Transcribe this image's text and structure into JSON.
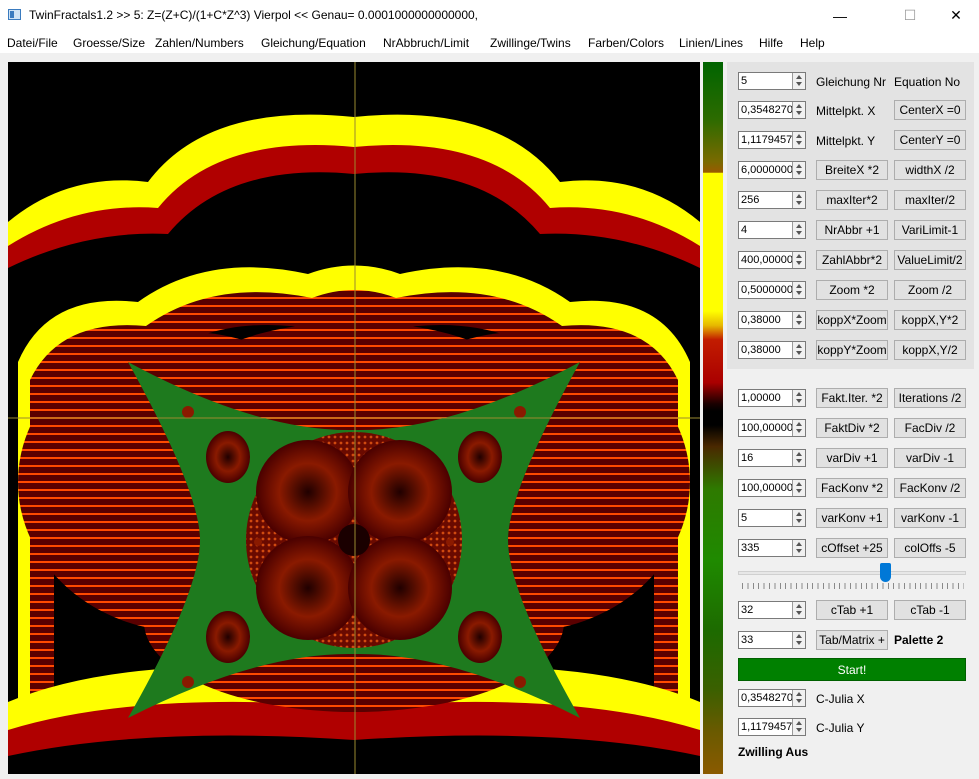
{
  "window": {
    "title": "TwinFractals1.2 >> 5: Z=(Z+C)/(1+C*Z^3) Vierpol << Genau= 0.0001000000000000,",
    "minimize": "—",
    "maximize": "☐",
    "close": "✕"
  },
  "menu": [
    "Datei/File",
    "Groesse/Size",
    "Zahlen/Numbers",
    "Gleichung/Equation",
    "NrAbbruch/Limit",
    "Zwillinge/Twins",
    "Farben/Colors",
    "Linien/Lines",
    "Hilfe",
    "Help"
  ],
  "panel": {
    "equation_no": "5",
    "label_gleichung": "Gleichung Nr",
    "label_equation": "Equation No",
    "mittelpkt_x": "0,3548270",
    "label_mittelpkt_x": "Mittelpkt. X",
    "btn_center_x": "CenterX =0",
    "mittelpkt_y": "1,1179457",
    "label_mittelpkt_y": "Mittelpkt. Y",
    "btn_center_y": "CenterY =0",
    "breite": "6,0000000",
    "btn_breite": "BreiteX *2",
    "btn_width": "widthX /2",
    "maxiter": "256",
    "btn_maxiter_mul": "maxIter*2",
    "btn_maxiter_div": "maxIter/2",
    "nrabbr": "4",
    "btn_nrabbr": "NrAbbr +1",
    "btn_varilimit": "VariLimit-1",
    "zahlabbr": "400,00000",
    "btn_zahlabbr": "ZahlAbbr*2",
    "btn_valuelimit": "ValueLimit/2",
    "zoom": "0,5000000",
    "btn_zoom_mul": "Zoom *2",
    "btn_zoom_div": "Zoom /2",
    "koppx": "0,38000",
    "btn_koppx_zoom": "koppX*Zoom",
    "btn_koppxy_mul": "koppX,Y*2",
    "koppy": "0,38000",
    "btn_koppy_zoom": "koppY*Zoom",
    "btn_koppxy_div": "koppX,Y/2"
  },
  "lower": {
    "fakt_iter": "1,00000",
    "btn_fakt_iter": "Fakt.Iter. *2",
    "btn_iterations": "Iterations /2",
    "fakt_div": "100,00000",
    "btn_fakt_div": "FaktDiv *2",
    "btn_fac_div": "FacDiv /2",
    "var_div": "16",
    "btn_var_div_plus": "varDiv +1",
    "btn_var_div_minus": "varDiv -1",
    "fac_konv": "100,00000",
    "btn_fac_konv_mul": "FacKonv *2",
    "btn_fac_konv_div": "FacKonv /2",
    "var_konv": "5",
    "btn_var_konv_plus": "varKonv +1",
    "btn_var_konv_minus": "varKonv -1",
    "c_offset": "335",
    "btn_c_offset": "cOffset +25",
    "btn_col_offs": "colOffs -5",
    "slider_level": 0.65,
    "c_tab": "32",
    "btn_c_tab_plus": "cTab +1",
    "btn_c_tab_minus": "cTab -1",
    "tab_matrix": "33",
    "btn_tab_matrix": "Tab/Matrix +",
    "palette": "Palette 2",
    "btn_start": "Start!",
    "c_julia_x": "0,3548270",
    "label_c_julia_x": "C-Julia X",
    "c_julia_y": "1,1179457",
    "label_c_julia_y": "C-Julia Y",
    "zwilling": "Zwilling Aus"
  },
  "colors": {
    "yellow": "#ffff00",
    "red": "#c00000",
    "dark_red": "#6a0000",
    "green": "#1e7a1e",
    "crosshair": "#9a8a30",
    "start_green": "#008000",
    "slider_blue": "#0078d7"
  }
}
